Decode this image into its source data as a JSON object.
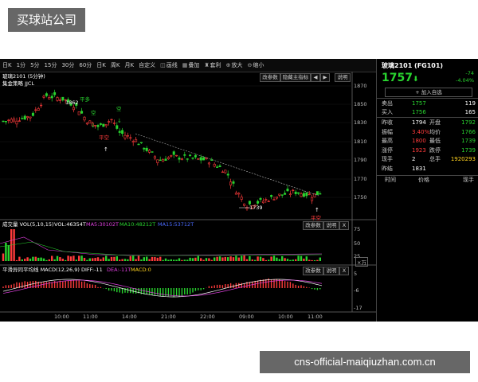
{
  "watermark_top": "买球站公司",
  "watermark_bottom": "cns-official-maiqiuzhan.com.cn",
  "toolbar": [
    {
      "icon": "",
      "label": "日K"
    },
    {
      "icon": "",
      "label": "1分"
    },
    {
      "icon": "",
      "label": "5分"
    },
    {
      "icon": "",
      "label": "15分"
    },
    {
      "icon": "",
      "label": "30分"
    },
    {
      "icon": "",
      "label": "60分"
    },
    {
      "icon": "",
      "label": "日K"
    },
    {
      "icon": "",
      "label": "周K"
    },
    {
      "icon": "",
      "label": "月K"
    },
    {
      "icon": "",
      "label": "自定义"
    },
    {
      "icon": "◫",
      "label": "画线"
    },
    {
      "icon": "▦",
      "label": "叠加"
    },
    {
      "icon": "♜",
      "label": "套利"
    },
    {
      "icon": "⊕",
      "label": "放大"
    },
    {
      "icon": "⊖",
      "label": "缩小"
    }
  ],
  "main_pane": {
    "title": "玻璃2101 (5分钟)",
    "strategy": "集金策略 JJCL",
    "btn_params": "改参数",
    "btn_hide": "隐藏主指标",
    "btn_left": "◀",
    "btn_right": "▶",
    "btn_help": "说明",
    "annotations": [
      {
        "text": "1862",
        "color": "#ffffff"
      },
      {
        "text": "平多",
        "color": "#29d42f"
      },
      {
        "text": "空",
        "color": "#29d42f"
      },
      {
        "text": "空",
        "color": "#29d42f"
      },
      {
        "text": "平空",
        "color": "#ff3b3b"
      },
      {
        "text": "1739",
        "color": "#ffffff"
      },
      {
        "text": "平空",
        "color": "#ff3b3b"
      }
    ],
    "y_ticks": [
      "1870",
      "1850",
      "1830",
      "1810",
      "1790",
      "1770",
      "1750"
    ]
  },
  "vol_pane": {
    "label": "成交量 VOL(5,10,15)",
    "vol": "VOL:46354T",
    "ma5": "MA5:30102T",
    "ma10": "MA10:48212T",
    "ma15": "MA15:53712T",
    "btn_params": "改参数",
    "btn_help": "说明",
    "btn_close": "X",
    "y_ticks": [
      "75",
      "50",
      "25"
    ],
    "unit": "×万"
  },
  "macd_pane": {
    "label": "平滑异同平均线 MACD(12,26,9)",
    "diff": "DIFF:-11",
    "dea": "DEA:-11T",
    "macd": "MACD:0",
    "btn_params": "改参数",
    "btn_help": "说明",
    "btn_close": "X",
    "y_ticks": [
      "5",
      "-6",
      "-17"
    ]
  },
  "x_ticks": [
    "10:00",
    "11:00",
    "14:00",
    "21:00",
    "22:00",
    "09:00",
    "10:00",
    "11:00"
  ],
  "side": {
    "title": "玻璃2101 (FG101)",
    "price": "1757",
    "change": "-74",
    "change_pct": "-4.04%",
    "add_btn": "+ 加入自选",
    "sell": {
      "label": "卖出",
      "price": "1757",
      "vol": "119"
    },
    "buy": {
      "label": "买入",
      "price": "1756",
      "vol": "165"
    },
    "stats": [
      {
        "l1": "昨收",
        "v1": "1794",
        "c1": "#ffffff",
        "l2": "开盘",
        "v2": "1792",
        "c2": "#29d42f"
      },
      {
        "l1": "振幅",
        "v1": "3.40%",
        "c1": "#ff3b3b",
        "l2": "均价",
        "v2": "1766",
        "c2": "#29d42f"
      },
      {
        "l1": "最高",
        "v1": "1800",
        "c1": "#ff3b3b",
        "l2": "最低",
        "v2": "1739",
        "c2": "#29d42f"
      },
      {
        "l1": "涨停",
        "v1": "1923",
        "c1": "#ff3b3b",
        "l2": "跌停",
        "v2": "1739",
        "c2": "#29d42f"
      },
      {
        "l1": "现手",
        "v1": "2",
        "c1": "#ffffff",
        "l2": "总手",
        "v2": "1920293",
        "c2": "#ffd21f"
      },
      {
        "l1": "昨结",
        "v1": "1831",
        "c1": "#ffffff",
        "l2": "",
        "v2": "",
        "c2": "#ffffff"
      }
    ],
    "tick_headers": [
      "时间",
      "价格",
      "现手"
    ]
  },
  "colors": {
    "up": "#ff3b3b",
    "down": "#29d42f",
    "bg": "#000000"
  }
}
